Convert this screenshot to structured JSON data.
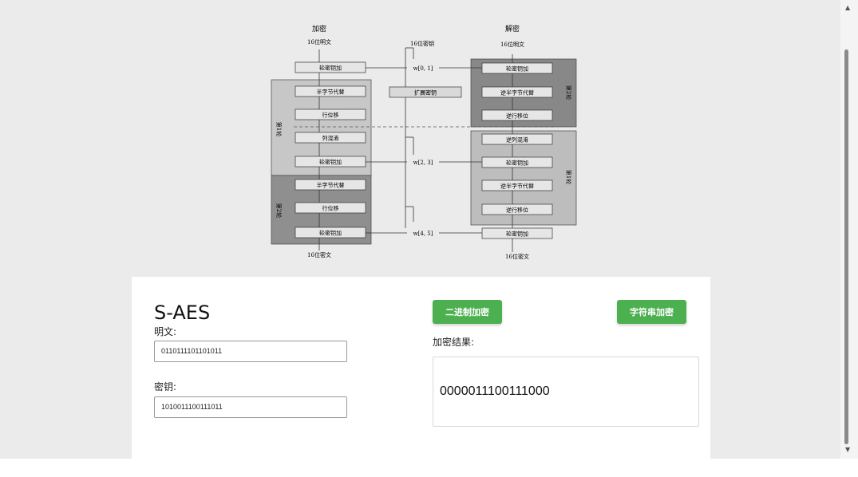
{
  "diagram": {
    "enc_title": "加密",
    "dec_title": "解密",
    "enc_plain": "16位明文",
    "dec_plain": "16位明文",
    "key_label": "16位密钥",
    "expand_label": "扩展密钥",
    "enc_cipher": "16位密文",
    "dec_cipher": "16位密文",
    "w01": "w[0, 1]",
    "w23": "w[2, 3]",
    "w45": "w[4, 5]",
    "enc_blocks": [
      "轮密钥加",
      "半字节代替",
      "行位移",
      "列混淆",
      "轮密钥加",
      "半字节代替",
      "行位移",
      "轮密钥加"
    ],
    "dec_blocks": [
      "轮密钥加",
      "逆半字节代替",
      "逆行移位",
      "逆列混淆",
      "轮密钥加",
      "逆半字节代替",
      "逆行移位",
      "轮密钥加"
    ],
    "round1": "第1轮",
    "round2": "第2轮"
  },
  "app": {
    "title": "S-AES",
    "plaintext_label": "明文:",
    "plaintext_value": "0110111101101011",
    "key_label": "密钥:",
    "key_value": "1010011100111011",
    "binary_encrypt_button": "二进制加密",
    "string_encrypt_button": "字符串加密",
    "result_label": "加密结果:",
    "result_value": "0000011100111000"
  },
  "colors": {
    "accent_green": "#4caf50",
    "page_bg": "#ebebeb",
    "card_bg": "#ffffff"
  }
}
